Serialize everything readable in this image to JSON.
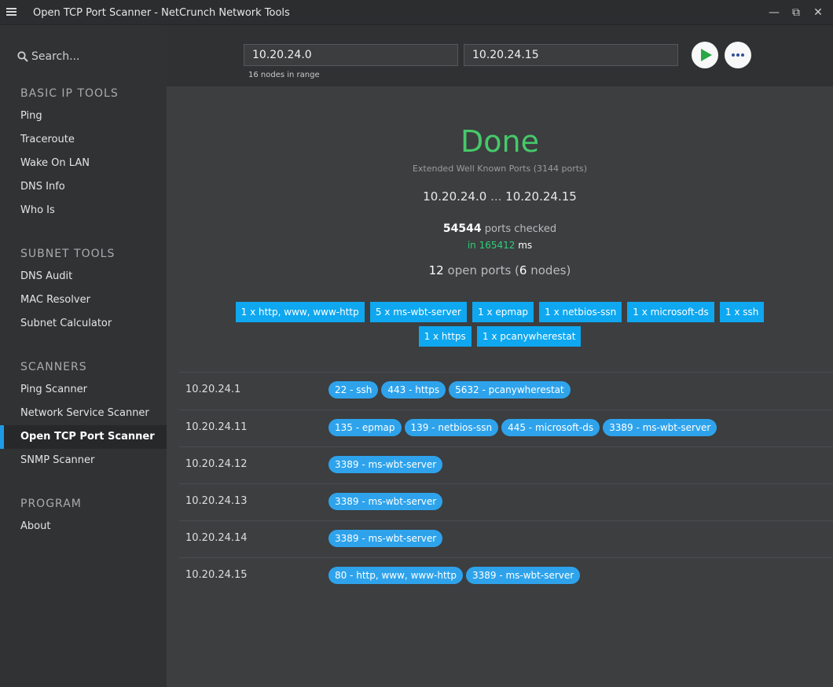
{
  "window": {
    "title": "Open TCP Port Scanner - NetCrunch Network Tools",
    "minimize_glyph": "—",
    "restore_glyph": "⧉",
    "close_glyph": "✕"
  },
  "sidebar": {
    "search_label": "Search...",
    "sections": [
      {
        "title": "BASIC IP TOOLS",
        "items": [
          "Ping",
          "Traceroute",
          "Wake On LAN",
          "DNS Info",
          "Who Is"
        ]
      },
      {
        "title": "SUBNET TOOLS",
        "items": [
          "DNS Audit",
          "MAC Resolver",
          "Subnet Calculator"
        ]
      },
      {
        "title": "SCANNERS",
        "items": [
          "Ping Scanner",
          "Network Service Scanner",
          "Open TCP Port Scanner",
          "SNMP Scanner"
        ]
      },
      {
        "title": "PROGRAM",
        "items": [
          "About"
        ]
      }
    ],
    "active_item": "Open TCP Port Scanner"
  },
  "topbar": {
    "start_ip": "10.20.24.0",
    "end_ip": "10.20.24.15",
    "range_info": "16 nodes in range"
  },
  "summary": {
    "status": "Done",
    "port_set": "Extended Well Known Ports (3144 ports)",
    "range_start": "10.20.24.0",
    "range_sep": "...",
    "range_end": "10.20.24.15",
    "ports_checked": "54544",
    "ports_checked_label": "ports checked",
    "time_prefix": "in",
    "time_value": "165412",
    "time_unit": "ms",
    "open_count": "12",
    "open_label": "open ports (",
    "node_count": "6",
    "node_label": "nodes)"
  },
  "service_chips": [
    [
      "1 x http, www, www-http",
      "5 x ms-wbt-server",
      "1 x epmap",
      "1 x netbios-ssn",
      "1 x microsoft-ds",
      "1 x ssh"
    ],
    [
      "1 x https",
      "1 x pcanywherestat"
    ]
  ],
  "results": [
    {
      "ip": "10.20.24.1",
      "ports": [
        "22 - ssh",
        "443 - https",
        "5632 - pcanywherestat"
      ]
    },
    {
      "ip": "10.20.24.11",
      "ports": [
        "135 - epmap",
        "139 - netbios-ssn",
        "445 - microsoft-ds",
        "3389 - ms-wbt-server"
      ]
    },
    {
      "ip": "10.20.24.12",
      "ports": [
        "3389 - ms-wbt-server"
      ]
    },
    {
      "ip": "10.20.24.13",
      "ports": [
        "3389 - ms-wbt-server"
      ]
    },
    {
      "ip": "10.20.24.14",
      "ports": [
        "3389 - ms-wbt-server"
      ]
    },
    {
      "ip": "10.20.24.15",
      "ports": [
        "80 - http, www, www-http",
        "3389 - ms-wbt-server"
      ]
    }
  ],
  "colors": {
    "done": "#46c96a",
    "timing": "#2ed07a",
    "chip": "#0ea7f0",
    "tag": "#2ea3ec",
    "active_marker": "#1e9ae6"
  }
}
